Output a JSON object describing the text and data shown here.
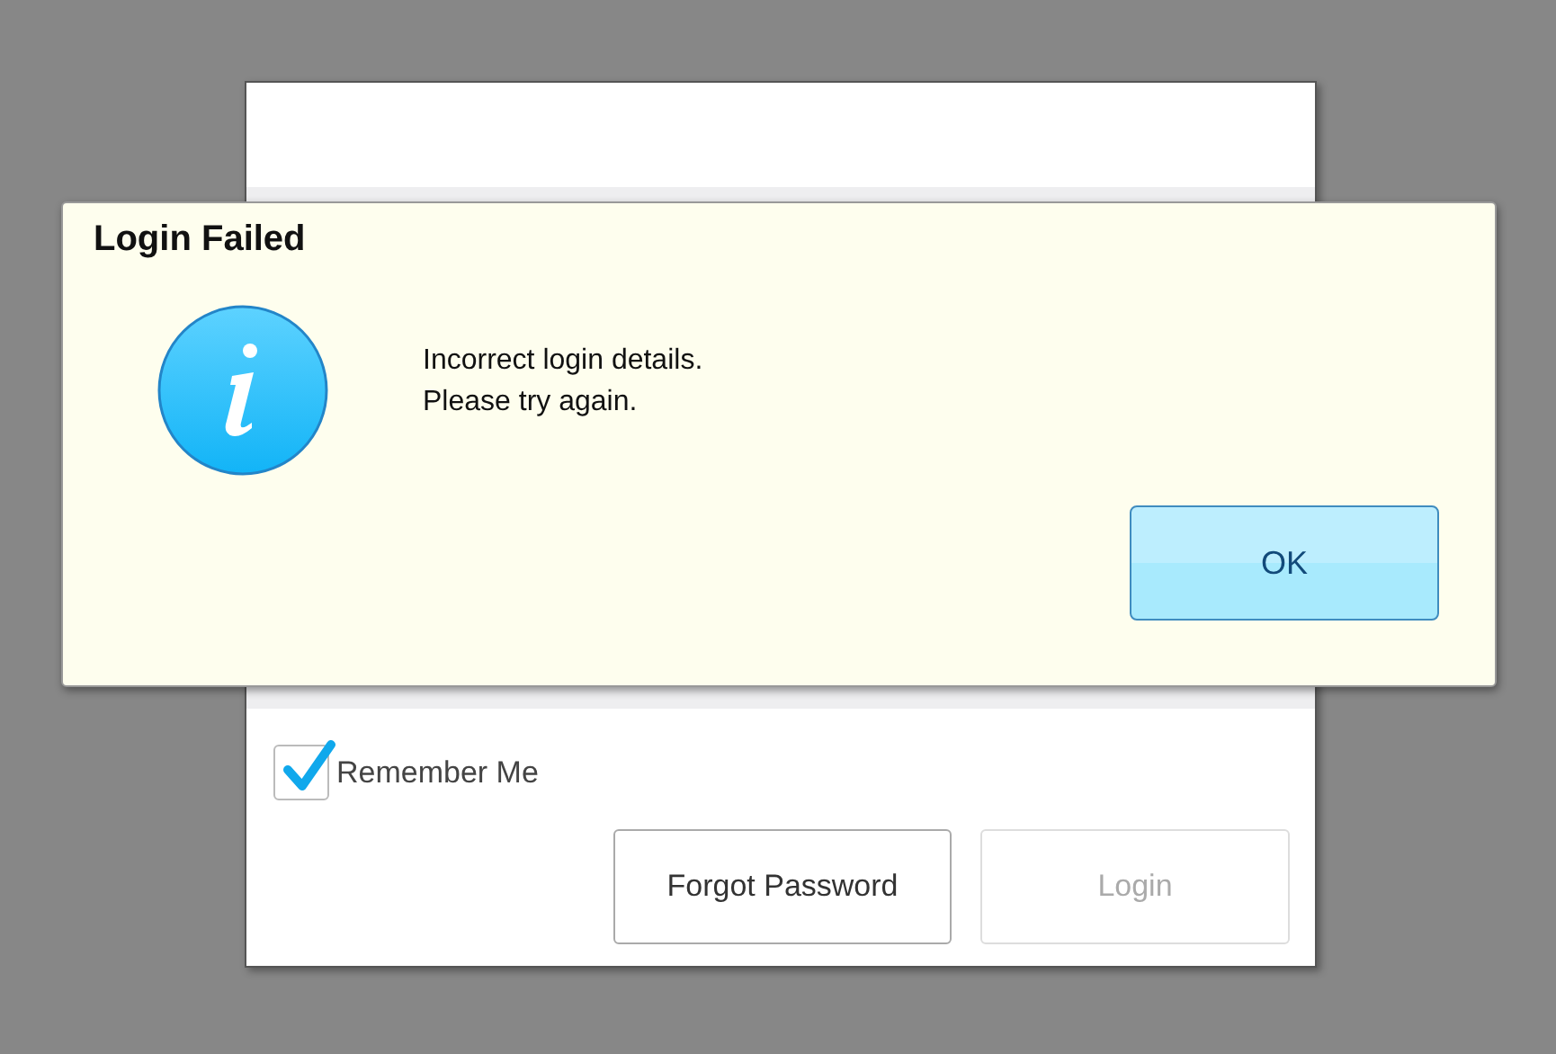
{
  "login_window": {
    "remember_me": {
      "label": "Remember Me",
      "checked": true
    },
    "buttons": [
      {
        "label": "Forgot Password",
        "disabled": false
      },
      {
        "label": "Login",
        "disabled": true
      }
    ]
  },
  "dialog": {
    "title": "Login Failed",
    "message_lines": [
      "Incorrect login details.",
      "Please try again."
    ],
    "button": "OK"
  }
}
